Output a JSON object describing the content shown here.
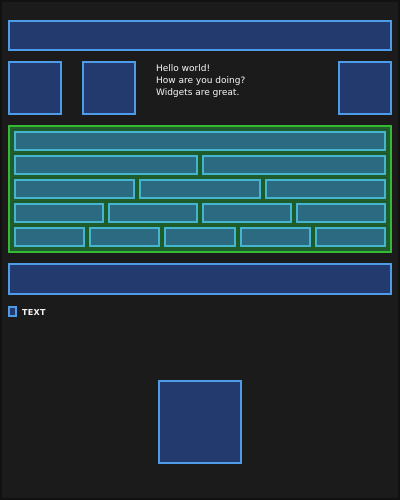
{
  "colors": {
    "background": "#1b1b1b",
    "box_fill": "#233a6f",
    "box_border": "#4e9be7",
    "panel_fill": "#1f5c2c",
    "panel_border": "#36b837",
    "cell_fill": "#2b6a80",
    "cell_border": "#45b4cf",
    "text": "#f2f2f2"
  },
  "message": {
    "lines": [
      "Hello world!",
      "How are you doing?",
      "Widgets are great."
    ]
  },
  "checkbox_label": "TEXT"
}
